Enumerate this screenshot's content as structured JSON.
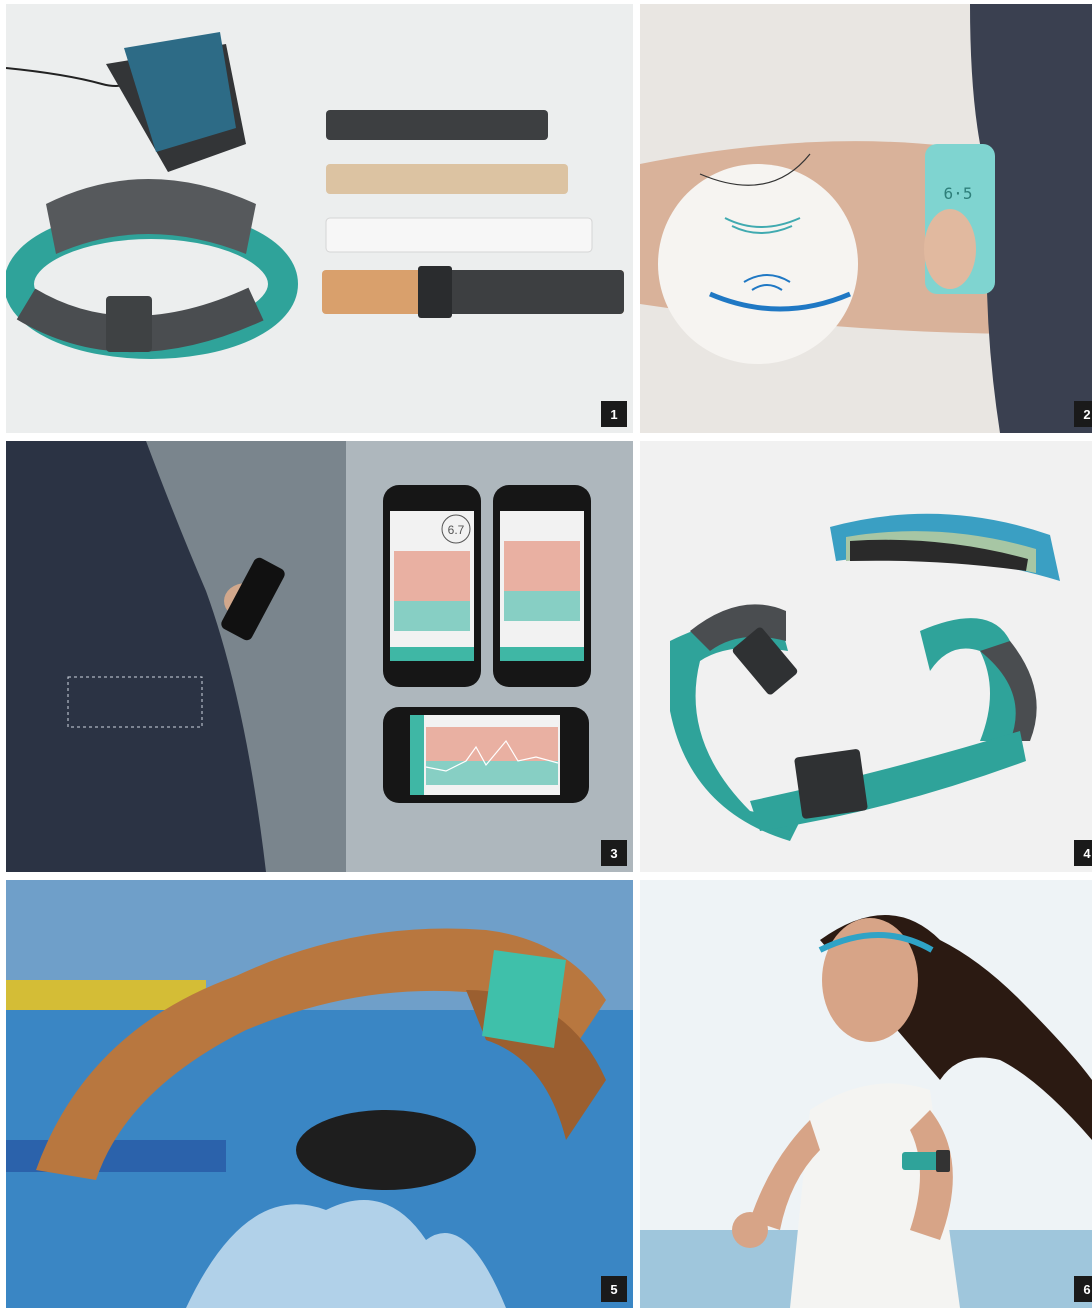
{
  "panels": [
    {
      "number": "1",
      "subject": "armband-device-and-straps"
    },
    {
      "number": "2",
      "subject": "wearing-armband-diagram"
    },
    {
      "number": "3",
      "subject": "phone-app-screens"
    },
    {
      "number": "4",
      "subject": "exploded-armband"
    },
    {
      "number": "5",
      "subject": "swimmer-with-armband"
    },
    {
      "number": "6",
      "subject": "runner-with-armband"
    }
  ],
  "device_screen_value": "6·5",
  "app_value": "6.7",
  "colors": {
    "teal": "#2fa39a",
    "dark_gray": "#4a4d50",
    "blue_device": "#2d6b86",
    "pool_blue": "#3a86c4",
    "badge": "#1a1a1a"
  }
}
